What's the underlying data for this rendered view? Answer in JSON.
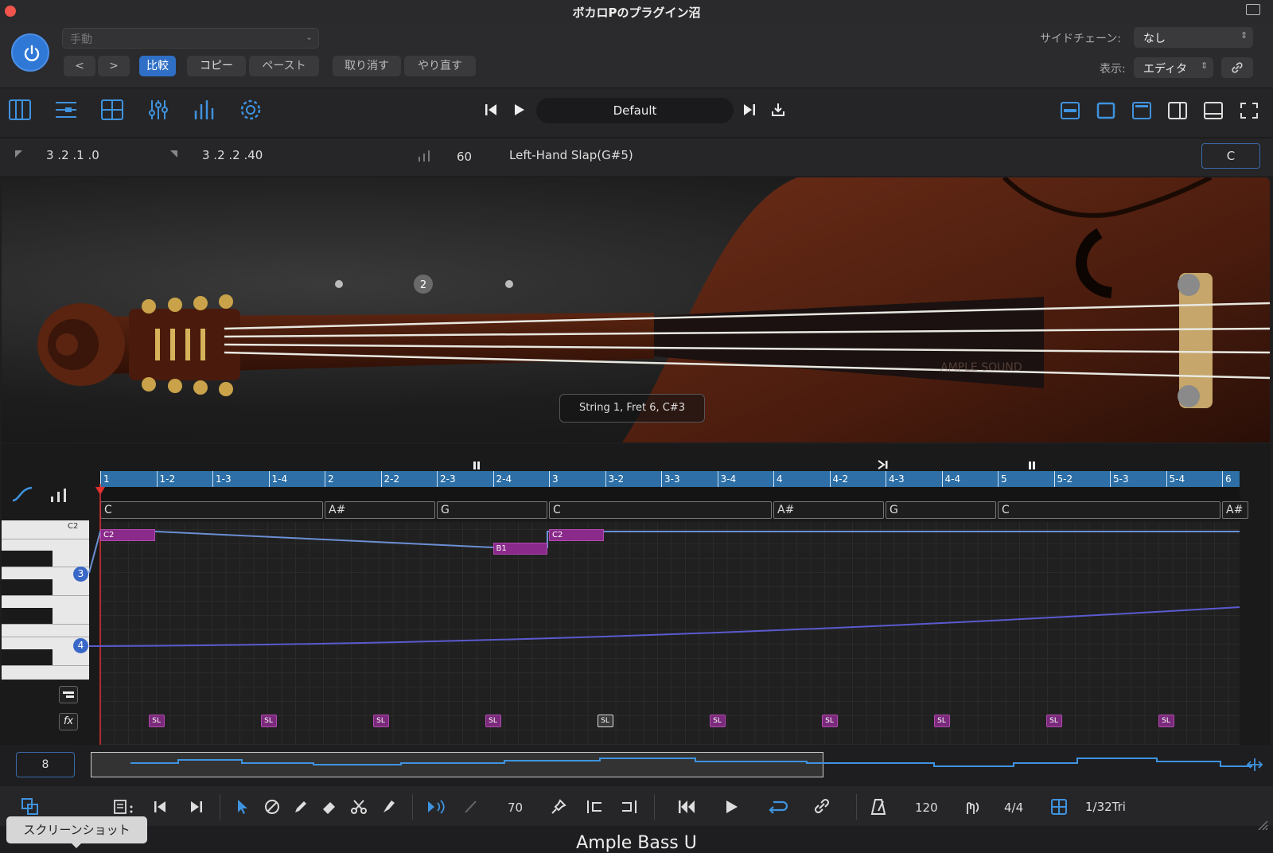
{
  "window": {
    "title": "ボカロPのプラグイン沼"
  },
  "header": {
    "preset_mode": "手動",
    "nav_prev": "<",
    "nav_next": ">",
    "compare_label": "比較",
    "copy_label": "コピー",
    "paste_label": "ペースト",
    "undo_label": "取り消す",
    "redo_label": "やり直す",
    "sidechain_label": "サイドチェーン:",
    "sidechain_value": "なし",
    "view_label": "表示:",
    "view_value": "エディタ"
  },
  "toolbar": {
    "preset_name": "Default"
  },
  "info": {
    "position_start": "3 .2 .1 .0",
    "position_end": "3 .2 .2 .40",
    "velocity": "60",
    "articulation": "Left-Hand Slap(G#5)",
    "key": "C"
  },
  "instrument": {
    "string_marker": "2",
    "status": "String 1, Fret 6, C#3",
    "brand_watermark": "AMPLE SOUND"
  },
  "editor": {
    "ruler": [
      "1",
      "1-2",
      "1-3",
      "1-4",
      "2",
      "2-2",
      "2-3",
      "2-4",
      "3",
      "3-2",
      "3-3",
      "3-4",
      "4",
      "4-2",
      "4-3",
      "4-4",
      "5",
      "5-2",
      "5-3",
      "5-4",
      "6"
    ],
    "chords": [
      {
        "label": "C",
        "start": 0,
        "span": 4
      },
      {
        "label": "A#",
        "start": 4,
        "span": 2
      },
      {
        "label": "G",
        "start": 6,
        "span": 2
      },
      {
        "label": "C",
        "start": 8,
        "span": 4
      },
      {
        "label": "A#",
        "start": 12,
        "span": 2
      },
      {
        "label": "G",
        "start": 14,
        "span": 2
      },
      {
        "label": "C",
        "start": 16,
        "span": 4
      },
      {
        "label": "A#",
        "start": 20,
        "span": 0.5
      }
    ],
    "piano_c2_label": "C2",
    "string_badge_3": "3",
    "string_badge_4": "4",
    "notes": [
      {
        "label": "C2",
        "beat": 0,
        "len": 1
      },
      {
        "label": "B1",
        "beat": 7,
        "len": 1
      },
      {
        "label": "C2",
        "beat": 8,
        "len": 1
      }
    ],
    "sl_label": "SL",
    "sl_beats": [
      1,
      3,
      5,
      7,
      9,
      11,
      13,
      15,
      17,
      19
    ],
    "fx_label": "fx"
  },
  "overview": {
    "zoom": "8"
  },
  "transport": {
    "velocity": "70",
    "tempo": "120",
    "time_signature": "4/4",
    "grid": "1/32Tri"
  },
  "tooltip": {
    "screenshot": "スクリーンショット"
  },
  "footer": {
    "plugin_name": "Ample Bass U"
  },
  "colors": {
    "accent": "#2f78d6",
    "note": "#8a2a8a",
    "ruler": "#2d6fa6"
  }
}
